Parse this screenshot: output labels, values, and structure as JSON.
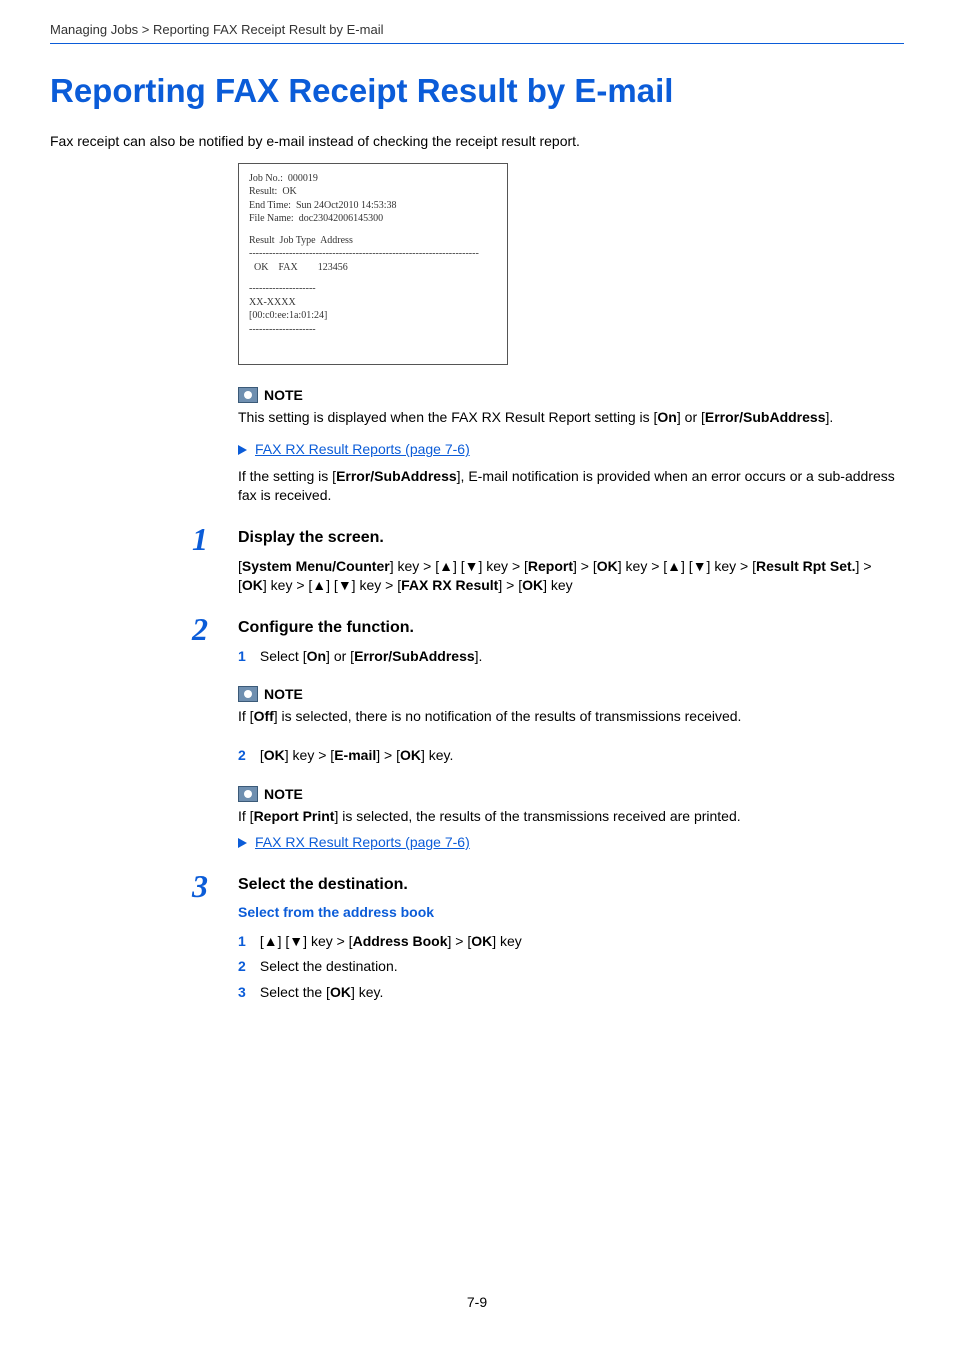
{
  "breadcrumb": "Managing Jobs > Reporting FAX Receipt Result by E-mail",
  "title": "Reporting FAX Receipt Result by E-mail",
  "intro": "Fax receipt can also be notified by e-mail instead of checking the receipt result report.",
  "email_sample": {
    "l1": "Job No.:  000019",
    "l2": "Result:  OK",
    "l3": "End Time:  Sun 24Oct2010 14:53:38",
    "l4": "File Name:  doc23042006145300",
    "l5": "Result  Job Type  Address",
    "l6": "---------------------------------------------------------------------",
    "l7": "  OK    FAX        123456",
    "l8": "--------------------",
    "l9": "XX-XXXX",
    "l10": "[00:c0:ee:1a:01:24]",
    "l11": "--------------------"
  },
  "note1": {
    "label": "NOTE",
    "text_a": "This setting is displayed when the FAX RX Result Report setting is [",
    "on": "On",
    "text_b": "] or [",
    "err": "Error/SubAddress",
    "text_c": "].",
    "link": "FAX RX Result Reports (page 7-6)",
    "text_d_a": "If the setting is [",
    "text_d_bold": "Error/SubAddress",
    "text_d_b": "], E-mail notification is provided when an error occurs or a sub-address fax is received."
  },
  "step1": {
    "num": "1",
    "title": "Display the screen.",
    "p": {
      "a": "[",
      "b1": "System Menu/Counter",
      "c": "] key > [▲] [▼] key > [",
      "b2": "Report",
      "d": "] > [",
      "b3": "OK",
      "e": "] key > [▲] [▼] key > [",
      "b4": "Result Rpt Set.",
      "f": "] > [",
      "b5": "OK",
      "g": "] key > [▲] [▼] key > [",
      "b6": "FAX RX Result",
      "h": "] > [",
      "b7": "OK",
      "i": "] key"
    }
  },
  "step2": {
    "num": "2",
    "title": "Configure the function.",
    "s1": {
      "n": "1",
      "a": "Select [",
      "b1": "On",
      "b": "] or [",
      "b2": "Error/SubAddress",
      "c": "]."
    },
    "note": {
      "label": "NOTE",
      "a": "If [",
      "b": "Off",
      "c": "] is selected, there is no notification of the results of transmissions received."
    },
    "s2": {
      "n": "2",
      "a": "[",
      "b1": "OK",
      "b": "] key > [",
      "b2": "E-mail",
      "c": "] > [",
      "b3": "OK",
      "d": "] key."
    },
    "note2": {
      "label": "NOTE",
      "a": "If [",
      "b": "Report Print",
      "c": "] is selected, the results of the transmissions received are printed.",
      "link": "FAX RX Result Reports (page 7-6)"
    }
  },
  "step3": {
    "num": "3",
    "title": "Select the destination.",
    "sub": "Select from the address book",
    "s1": {
      "n": "1",
      "a": "[▲] [▼] key > [",
      "b": "Address Book",
      "c": "] > [",
      "d": "OK",
      "e": "] key"
    },
    "s2": {
      "n": "2",
      "t": "Select the destination."
    },
    "s3": {
      "n": "3",
      "a": "Select the [",
      "b": "OK",
      "c": "] key."
    }
  },
  "page_number": "7-9"
}
